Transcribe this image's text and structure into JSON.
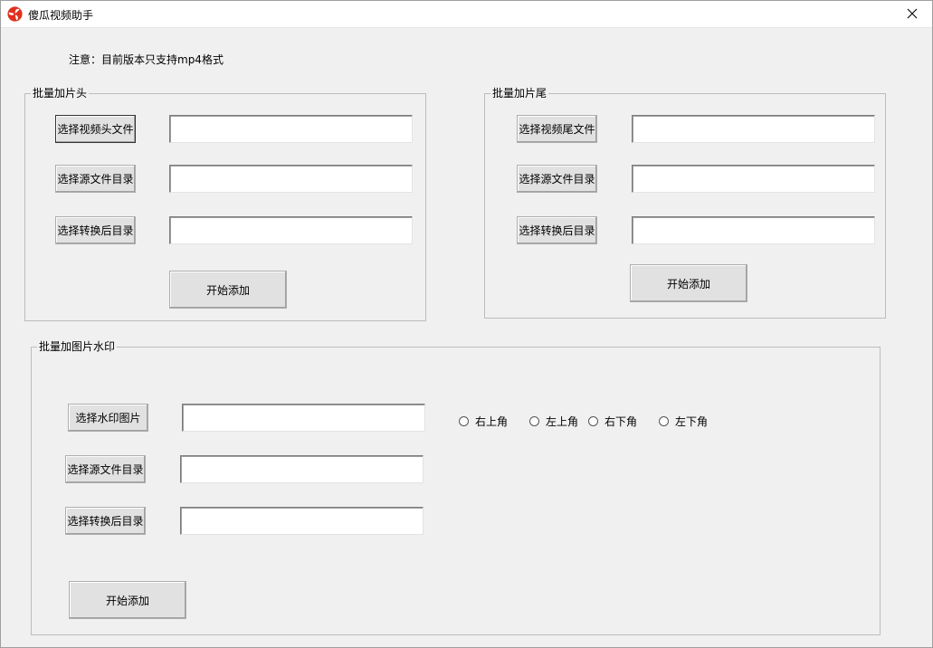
{
  "window": {
    "title": "傻瓜视频助手",
    "close_glyph": "✕"
  },
  "notice": "注意：目前版本只支持mp4格式",
  "intro_group": {
    "legend": "批量加片头",
    "select_file_label": "选择视频头文件",
    "select_source_label": "选择源文件目录",
    "select_output_label": "选择转换后目录",
    "file_value": "",
    "source_value": "",
    "output_value": "",
    "start_label": "开始添加"
  },
  "outro_group": {
    "legend": "批量加片尾",
    "select_file_label": "选择视频尾文件",
    "select_source_label": "选择源文件目录",
    "select_output_label": "选择转换后目录",
    "file_value": "",
    "source_value": "",
    "output_value": "",
    "start_label": "开始添加"
  },
  "watermark_group": {
    "legend": "批量加图片水印",
    "select_image_label": "选择水印图片",
    "select_source_label": "选择源文件目录",
    "select_output_label": "选择转换后目录",
    "image_value": "",
    "source_value": "",
    "output_value": "",
    "positions": [
      "右上角",
      "左上角",
      "右下角",
      "左下角"
    ],
    "start_label": "开始添加"
  },
  "icons": {
    "app": "fan-logo-icon",
    "close": "close-icon"
  },
  "colors": {
    "background": "#f0f0f0",
    "titlebar": "#ffffff",
    "logo": "#e0301e"
  }
}
